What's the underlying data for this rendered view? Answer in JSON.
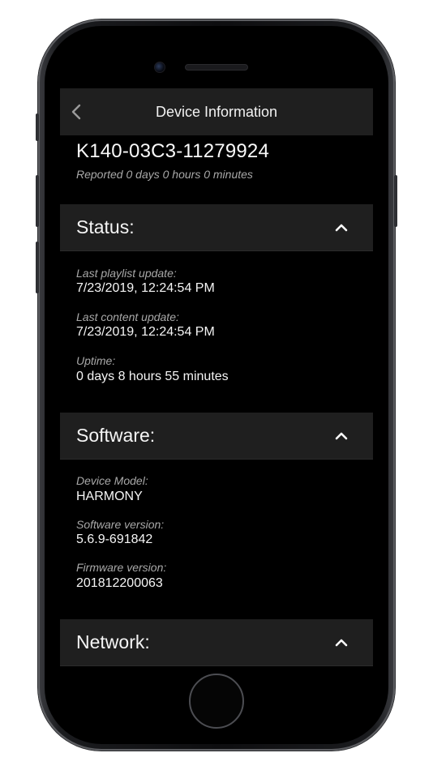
{
  "nav": {
    "title": "Device Information",
    "back_icon": "chevron-left-icon"
  },
  "device": {
    "id": "K140-03C3-11279924",
    "reported": "Reported 0 days 0 hours 0 minutes"
  },
  "sections": [
    {
      "title": "Status:",
      "expanded": true,
      "fields": [
        {
          "label": "Last playlist update:",
          "value": "7/23/2019, 12:24:54 PM"
        },
        {
          "label": "Last content update:",
          "value": "7/23/2019, 12:24:54 PM"
        },
        {
          "label": "Uptime:",
          "value": "0 days 8 hours 55 minutes"
        }
      ]
    },
    {
      "title": "Software:",
      "expanded": true,
      "fields": [
        {
          "label": "Device Model:",
          "value": "HARMONY"
        },
        {
          "label": "Software version:",
          "value": "5.6.9-691842"
        },
        {
          "label": "Firmware version:",
          "value": "201812200063"
        }
      ]
    },
    {
      "title": "Network:",
      "expanded": true,
      "fields": []
    }
  ],
  "colors": {
    "background": "#000000",
    "header": "#1f1f1f",
    "label": "#a8a8a8",
    "text": "#f5f5f5"
  }
}
